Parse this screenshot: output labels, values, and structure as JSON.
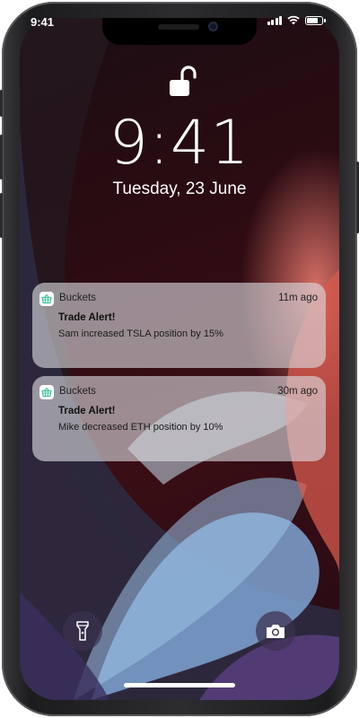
{
  "status_bar": {
    "time": "9:41"
  },
  "lock_screen": {
    "time": "9:41",
    "date": "Tuesday, 23 June"
  },
  "notifications": [
    {
      "app": "Buckets",
      "time_ago": "11m ago",
      "title": "Trade Alert!",
      "body": "Sam increased TSLA position by 15%"
    },
    {
      "app": "Buckets",
      "time_ago": "30m ago",
      "title": "Trade Alert!",
      "body": "Mike decreased ETH position by 10%"
    }
  ],
  "quick_actions": {
    "left": "flashlight-icon",
    "right": "camera-icon"
  },
  "colors": {
    "app_icon_accent": "#3fc2a0",
    "notification_bg": "#dcdce1"
  }
}
